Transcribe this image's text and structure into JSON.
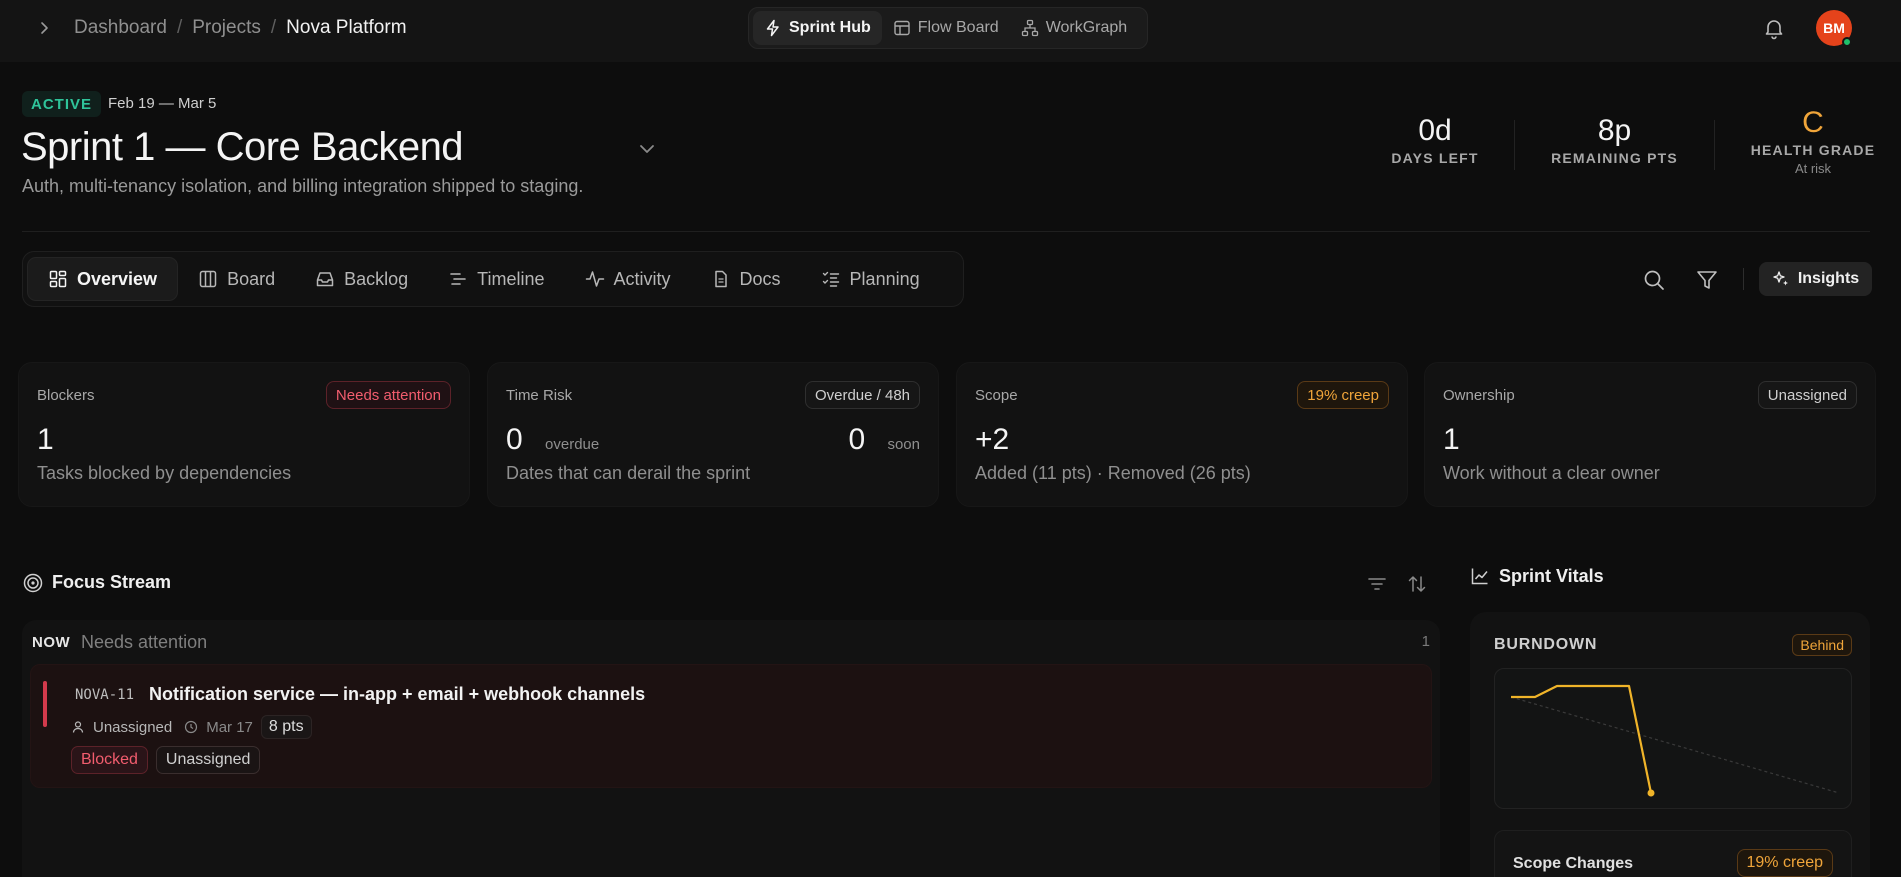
{
  "breadcrumb": {
    "items": [
      "Dashboard",
      "Projects"
    ],
    "separator": "/",
    "current": "Nova Platform"
  },
  "view_switcher": [
    {
      "label": "Sprint Hub",
      "icon": "lightning-icon",
      "active": true
    },
    {
      "label": "Flow Board",
      "icon": "board-layout-icon",
      "active": false
    },
    {
      "label": "WorkGraph",
      "icon": "network-icon",
      "active": false
    }
  ],
  "user": {
    "initials": "BM",
    "status": "online",
    "avatar_color": "#e5431b"
  },
  "sprint": {
    "status": "ACTIVE",
    "dates": "Feb 19 — Mar 5",
    "title": "Sprint 1 — Core Backend",
    "description": "Auth, multi-tenancy isolation, and billing integration shipped to staging."
  },
  "stats": {
    "days_left": {
      "value": "0d",
      "label": "DAYS LEFT"
    },
    "remaining": {
      "value": "8p",
      "label": "REMAINING PTS"
    },
    "health": {
      "value": "C",
      "label": "HEALTH GRADE",
      "sub": "At risk",
      "color": "#f0a53a"
    }
  },
  "tabs": [
    {
      "label": "Overview",
      "icon": "grid-icon",
      "active": true
    },
    {
      "label": "Board",
      "icon": "columns-icon",
      "active": false
    },
    {
      "label": "Backlog",
      "icon": "inbox-icon",
      "active": false
    },
    {
      "label": "Timeline",
      "icon": "timeline-icon",
      "active": false
    },
    {
      "label": "Activity",
      "icon": "pulse-icon",
      "active": false
    },
    {
      "label": "Docs",
      "icon": "document-icon",
      "active": false
    },
    {
      "label": "Planning",
      "icon": "checklist-icon",
      "active": false
    }
  ],
  "toolbar": {
    "insights_label": "Insights"
  },
  "metrics": {
    "blockers": {
      "label": "Blockers",
      "pill": "Needs attention",
      "value": "1",
      "desc": "Tasks blocked by dependencies"
    },
    "time_risk": {
      "label": "Time Risk",
      "pill": "Overdue / 48h",
      "overdue_value": "0",
      "overdue_label": "overdue",
      "soon_value": "0",
      "soon_label": "soon",
      "desc": "Dates that can derail the sprint"
    },
    "scope": {
      "label": "Scope",
      "pill": "19% creep",
      "value": "+2",
      "desc": "Added (11 pts) · Removed (26 pts)"
    },
    "ownership": {
      "label": "Ownership",
      "pill": "Unassigned",
      "value": "1",
      "desc": "Work without a clear owner"
    }
  },
  "focus_stream": {
    "title": "Focus Stream",
    "group": {
      "label": "NOW",
      "sub": "Needs attention",
      "count": "1"
    },
    "task": {
      "key": "NOVA-11",
      "title": "Notification service — in-app + email + webhook channels",
      "assignee": "Unassigned",
      "due": "Mar 17",
      "points": "8 pts",
      "tags": [
        "Blocked",
        "Unassigned"
      ]
    }
  },
  "sprint_vitals": {
    "title": "Sprint Vitals",
    "burndown": {
      "label": "BURNDOWN",
      "status": "Behind",
      "line_color": "#f0b429"
    },
    "scope_changes": {
      "label": "Scope Changes",
      "pill": "19% creep"
    }
  }
}
